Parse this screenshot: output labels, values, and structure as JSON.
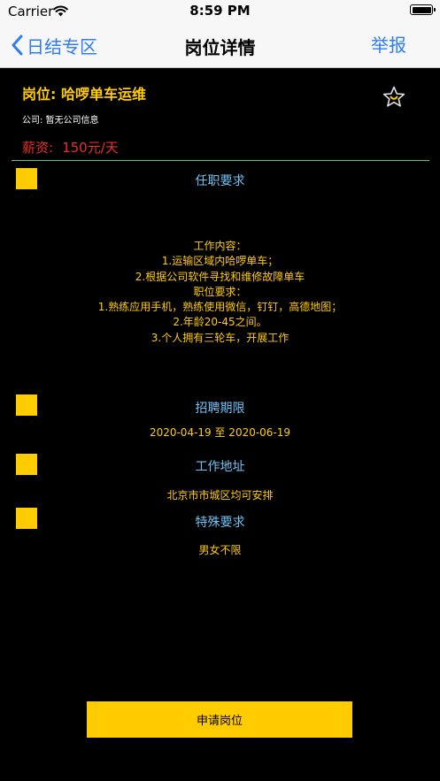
{
  "status_bar": {
    "carrier": "Carrier",
    "time": "8:59 PM",
    "icons": [
      "wifi-icon",
      "battery-icon"
    ]
  },
  "nav": {
    "back_label": "日结专区",
    "title": "岗位详情",
    "report_label": "举报",
    "back_icon": "chevron-left-icon"
  },
  "job": {
    "title": "岗位: 哈啰单车运维",
    "company": "公司: 暂无公司信息",
    "salary_label": "薪资:",
    "salary_value": "150元/天",
    "favorite_icon": "star-icon"
  },
  "sections": {
    "requirements": {
      "title": "任职要求",
      "lines": [
        "工作内容：",
        "1.运输区域内哈啰单车；",
        "2.根据公司软件寻找和维修故障单车",
        "职位要求：",
        "1.熟练应用手机，熟练使用微信，钉钉，高德地图；",
        "2.年龄20-45之间。",
        "3.个人拥有三轮车，开展工作"
      ]
    },
    "period": {
      "title": "招聘期限",
      "text": "2020-04-19 至 2020-06-19"
    },
    "location": {
      "title": "工作地址",
      "text": "北京市市城区均可安排"
    },
    "special": {
      "title": "特殊要求",
      "text": "男女不限"
    }
  },
  "apply_button": {
    "label": "申请岗位"
  },
  "colors": {
    "accent": "#ffcc00",
    "link_blue": "#2e7cf6",
    "section_title": "#6fc3f7",
    "salary_red": "#e6302b",
    "divider_green": "#5cc87a",
    "background": "#000000"
  }
}
